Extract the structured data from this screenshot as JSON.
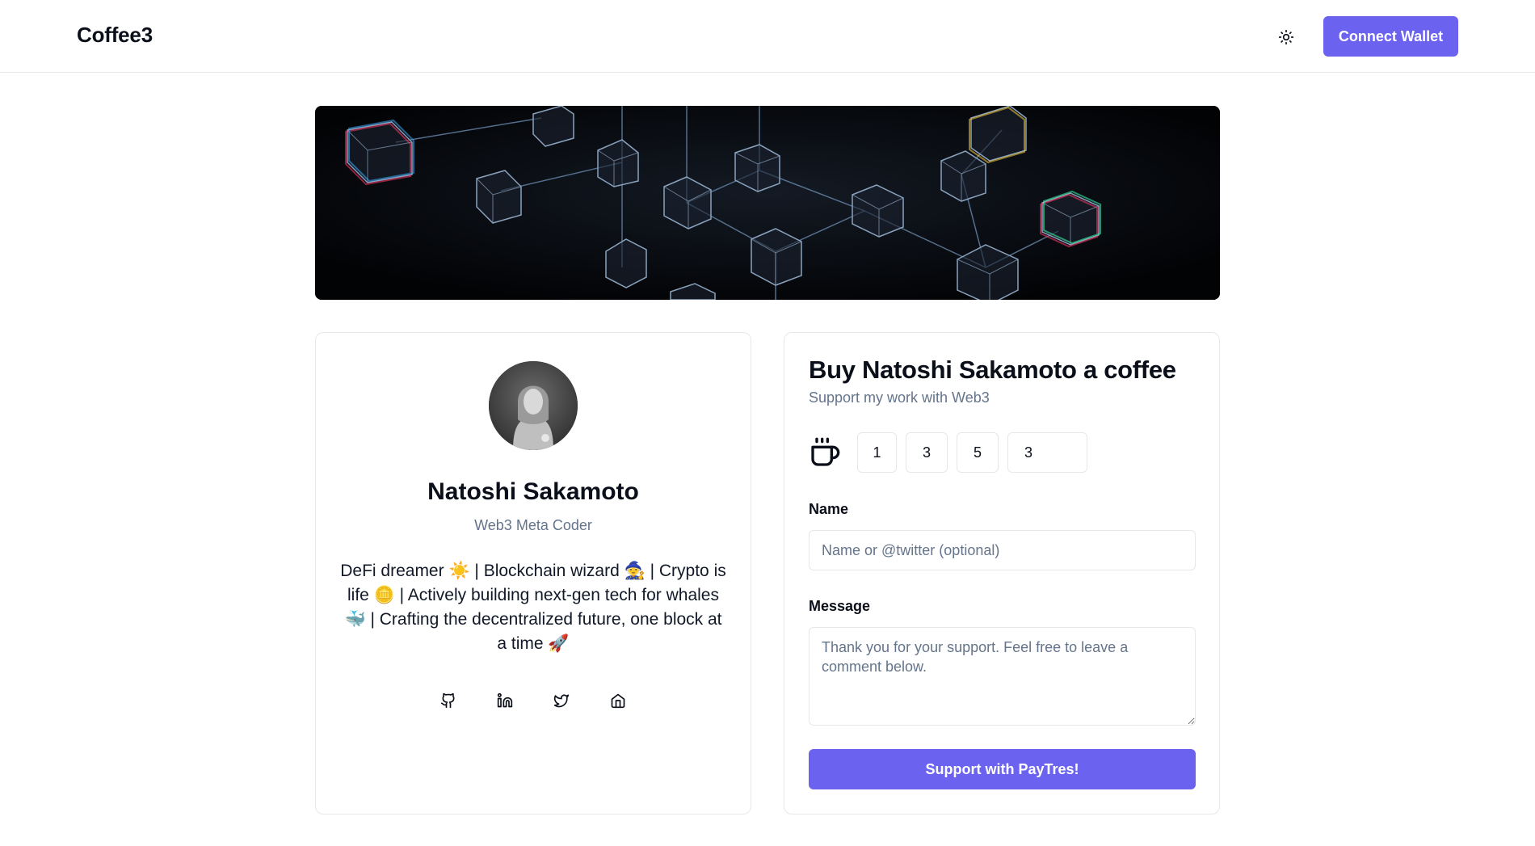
{
  "header": {
    "brand": "Coffee3",
    "theme_toggle_icon": "sun-icon",
    "connect_label": "Connect Wallet"
  },
  "banner": {
    "description_icon": "blockchain-network-image"
  },
  "profile": {
    "name": "Natoshi Sakamoto",
    "title": "Web3 Meta Coder",
    "bio": "DeFi dreamer ☀️ | Blockchain wizard 🧙 | Crypto is life 🪙 | Actively building next-gen tech for whales 🐳 | Crafting the decentralized future, one block at a time 🚀",
    "socials": [
      "github-icon",
      "linkedin-icon",
      "twitter-icon",
      "home-icon"
    ]
  },
  "support": {
    "title": "Buy Natoshi Sakamoto a coffee",
    "subtitle": "Support my work with Web3",
    "amounts": [
      "1",
      "3",
      "5"
    ],
    "custom_amount": "3",
    "name_label": "Name",
    "name_placeholder": "Name or @twitter (optional)",
    "message_label": "Message",
    "message_placeholder": "Thank you for your support. Feel free to leave a comment below.",
    "submit_label": "Support with PayTres!"
  },
  "colors": {
    "accent": "#6b63f0",
    "border": "#e5e7eb",
    "muted": "#64748b"
  }
}
